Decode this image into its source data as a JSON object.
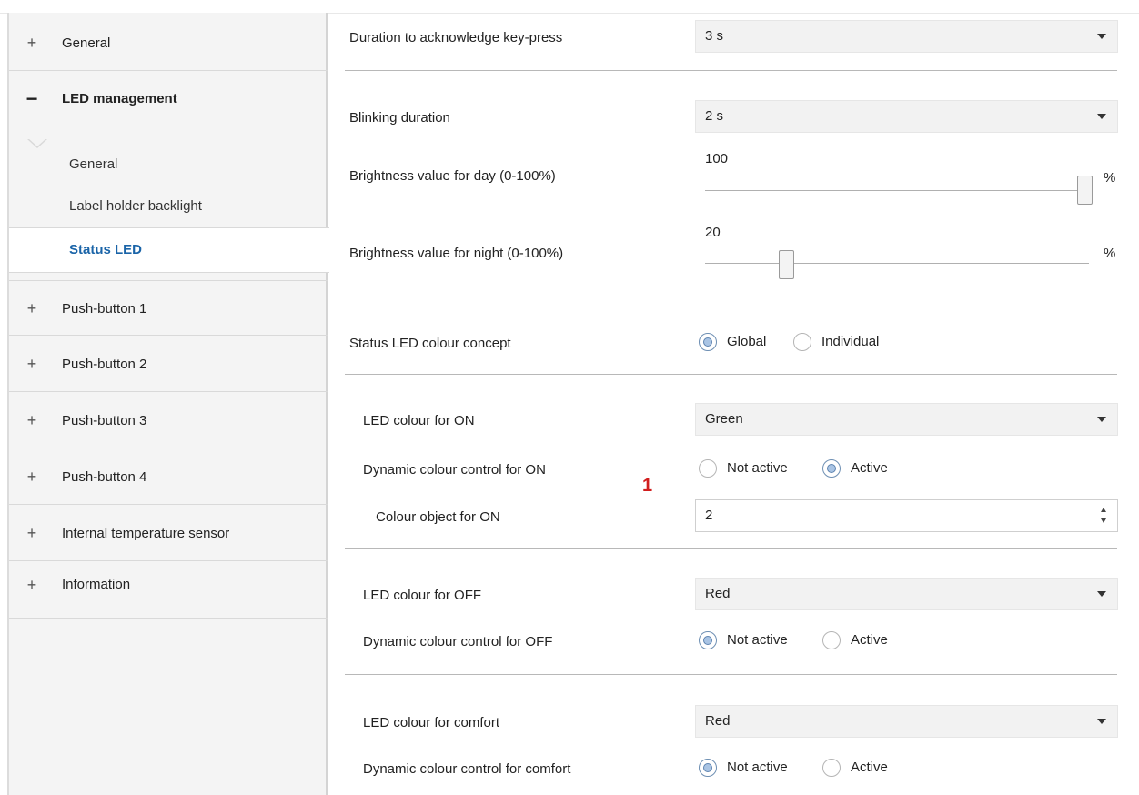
{
  "sidebar": {
    "items": [
      {
        "sign": "+",
        "label": "General"
      },
      {
        "sign": "−",
        "label": "LED management"
      },
      {
        "sign": "+",
        "label": "Push-button 1"
      },
      {
        "sign": "+",
        "label": "Push-button 2"
      },
      {
        "sign": "+",
        "label": "Push-button 3"
      },
      {
        "sign": "+",
        "label": "Push-button 4"
      },
      {
        "sign": "+",
        "label": "Internal temperature sensor"
      },
      {
        "sign": "+",
        "label": "Information"
      }
    ],
    "subitems": [
      {
        "label": "General"
      },
      {
        "label": "Label holder backlight"
      },
      {
        "label": "Status LED",
        "selected": true
      }
    ]
  },
  "main": {
    "ack_duration": {
      "label": "Duration to acknowledge key-press",
      "value": "3 s"
    },
    "blink_duration": {
      "label": "Blinking duration",
      "value": "2 s"
    },
    "brightness_day": {
      "label": "Brightness value for day (0-100%)",
      "value": "100",
      "unit": "%",
      "level": 100
    },
    "brightness_night": {
      "label": "Brightness value for night (0-100%)",
      "value": "20",
      "unit": "%",
      "level": 20
    },
    "colour_concept": {
      "label": "Status LED colour concept",
      "options": [
        "Global",
        "Individual"
      ],
      "selected": "Global"
    },
    "on_colour": {
      "label": "LED colour for ON",
      "value": "Green"
    },
    "on_dynamic": {
      "label": "Dynamic colour control for ON",
      "options": [
        "Not active",
        "Active"
      ],
      "selected": "Active"
    },
    "on_object": {
      "label": "Colour object for ON",
      "value": "2"
    },
    "off_colour": {
      "label": "LED colour for OFF",
      "value": "Red"
    },
    "off_dynamic": {
      "label": "Dynamic colour control for OFF",
      "options": [
        "Not active",
        "Active"
      ],
      "selected": "Not active"
    },
    "comfort_colour": {
      "label": "LED colour for comfort",
      "value": "Red"
    },
    "comfort_dynamic": {
      "label": "Dynamic colour control for comfort",
      "options": [
        "Not active",
        "Active"
      ],
      "selected": "Not active"
    }
  },
  "annotation": {
    "marker": "1",
    "color": "#d11d1d"
  }
}
